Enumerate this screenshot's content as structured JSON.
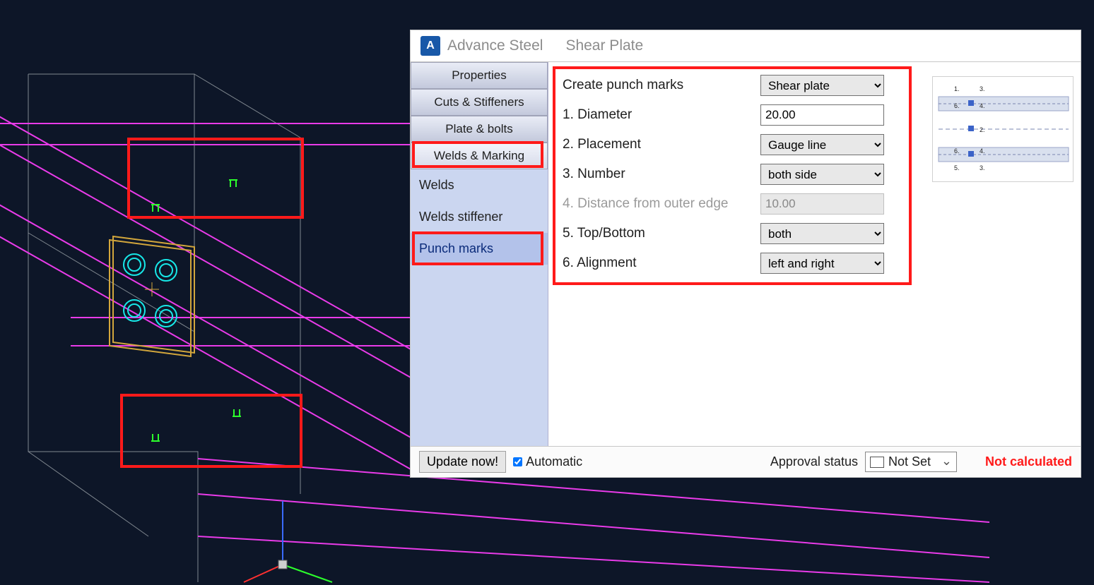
{
  "dialog": {
    "app_name": "Advance Steel",
    "doc_name": "Shear Plate",
    "sidebar": {
      "groups": [
        {
          "label": "Properties"
        },
        {
          "label": "Cuts & Stiffeners"
        },
        {
          "label": "Plate & bolts"
        },
        {
          "label": "Welds & Marking",
          "active": true
        }
      ],
      "items": [
        {
          "label": "Welds"
        },
        {
          "label": "Welds stiffener"
        },
        {
          "label": "Punch marks",
          "selected": true
        }
      ]
    },
    "form": {
      "create_label": "Create punch marks",
      "create_value": "Shear plate",
      "diameter_label": "1. Diameter",
      "diameter_value": "20.00",
      "placement_label": "2. Placement",
      "placement_value": "Gauge line",
      "number_label": "3. Number",
      "number_value": "both side",
      "distance_label": "4. Distance from outer edge",
      "distance_value": "10.00",
      "topbottom_label": "5. Top/Bottom",
      "topbottom_value": "both",
      "alignment_label": "6. Alignment",
      "alignment_value": "left and right"
    },
    "footer": {
      "update_label": "Update now!",
      "automatic_label": "Automatic",
      "automatic_checked": true,
      "approval_label": "Approval status",
      "approval_value": "Not Set",
      "calc_status": "Not calculated"
    }
  },
  "preview_labels": [
    "1.",
    "2.",
    "3.",
    "4.",
    "5.",
    "6."
  ]
}
